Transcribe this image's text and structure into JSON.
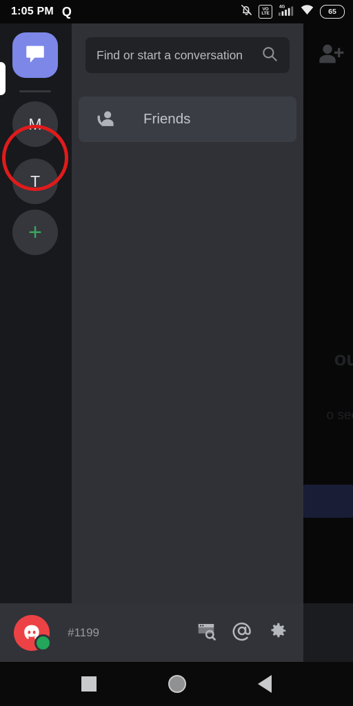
{
  "status_bar": {
    "time": "1:05 PM",
    "app_indicator": "Q",
    "icons": [
      "bell-off-icon",
      "volte-icon",
      "signal-4g-icon",
      "wifi-icon",
      "battery-icon"
    ],
    "volte_top": "VO",
    "volte_bottom": "LTE",
    "network_type": "4G",
    "battery_level": "65"
  },
  "server_rail": {
    "home_label": "Direct Messages",
    "home_icon": "speech-bubble-icon",
    "servers": [
      {
        "label": "M",
        "name": "server-m"
      },
      {
        "label": "T",
        "name": "server-t",
        "highlighted": true
      }
    ],
    "add_server_label": "+",
    "add_server_icon": "plus-icon"
  },
  "annotation": {
    "type": "circle-highlight",
    "target": "server-t",
    "color": "#e01b1b"
  },
  "drawer": {
    "search": {
      "placeholder": "Find or start a conversation",
      "value": "",
      "icon": "search-icon"
    },
    "items": [
      {
        "label": "Friends",
        "icon": "friends-wave-icon",
        "selected": true
      }
    ]
  },
  "user_bar": {
    "avatar_icon": "discord-logo-icon",
    "status": "online",
    "status_color": "#23a55a",
    "user_tag": "#1199",
    "actions": [
      {
        "name": "search-explore-button",
        "icon": "window-search-icon"
      },
      {
        "name": "mentions-button",
        "icon": "at-sign-icon"
      },
      {
        "name": "settings-button",
        "icon": "gear-icon"
      }
    ]
  },
  "background_app": {
    "add_friend_icon": "person-add-icon",
    "empty_heading_fragment": "ou",
    "empty_subtitle_fragment": "o see",
    "cta_button_color": "#3b4278"
  },
  "nav_bar": {
    "buttons": [
      {
        "name": "recents-button",
        "icon": "square-icon"
      },
      {
        "name": "home-button",
        "icon": "circle-icon"
      },
      {
        "name": "back-button",
        "icon": "triangle-left-icon"
      }
    ]
  }
}
